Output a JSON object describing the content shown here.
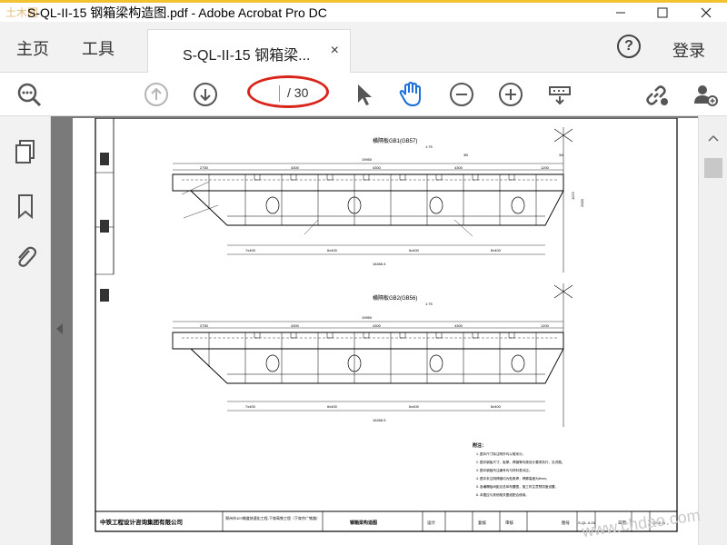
{
  "window": {
    "title": "S-QL-II-15 钢箱梁构造图.pdf - Adobe Acrobat Pro DC",
    "watermark_logo": "土木网"
  },
  "nav": {
    "home": "主页",
    "tools": "工具"
  },
  "doc_tab": {
    "label": "S-QL-II-15 钢箱梁...",
    "close": "×"
  },
  "header": {
    "help": "?",
    "login": "登录"
  },
  "toolbar": {
    "current_page": "",
    "total_pages": "/ 30"
  },
  "drawing": {
    "section1_title": "横隔板GB1(GB57)",
    "section2_title": "横隔板GB2(GB56)",
    "scale": "1:75",
    "top_dims": [
      "2750",
      "4300",
      "4300",
      "4300",
      "1200"
    ],
    "overall_1": "19950",
    "overall_2": "19950",
    "bottom_dims": [
      "7x400",
      "6x400",
      "6x400",
      "8x400"
    ],
    "total_len_1": "16466.4",
    "total_len_2": "16456.5",
    "side_dims": [
      "1072",
      "2000"
    ],
    "section_marks": [
      "3B",
      "3A"
    ],
    "notes_title": "附注：",
    "notes": [
      "1. 图中尺寸除注明外均以毫米计。",
      "2. 图中钢板尺寸、板厚、焊缝等均按设计要求执行，见详图。",
      "3. 图中钢板所注编号均与材料表对应。",
      "4. 图中未注明焊缝均为贴角焊，焊脚高度为8mm。",
      "5. 各横隔板间距见总体布置图，施工时注意预拱度设置。",
      "6. 本图应与其他相关图纸配合使用。"
    ],
    "title_block": {
      "company": "中铁工程设计咨询集团有限公司",
      "project": "郑州市107辅道快速化工程-下穿高铁工程（下穿京广铁路）",
      "drawing_name": "钢箱梁构造图",
      "design": "设计",
      "review": "复核",
      "audit": "审核",
      "drawing_no_label": "图号",
      "drawing_no": "S-QL-II-15",
      "date_label": "日期",
      "date": "2015.11"
    }
  },
  "site_watermark": "www.chdao.com"
}
